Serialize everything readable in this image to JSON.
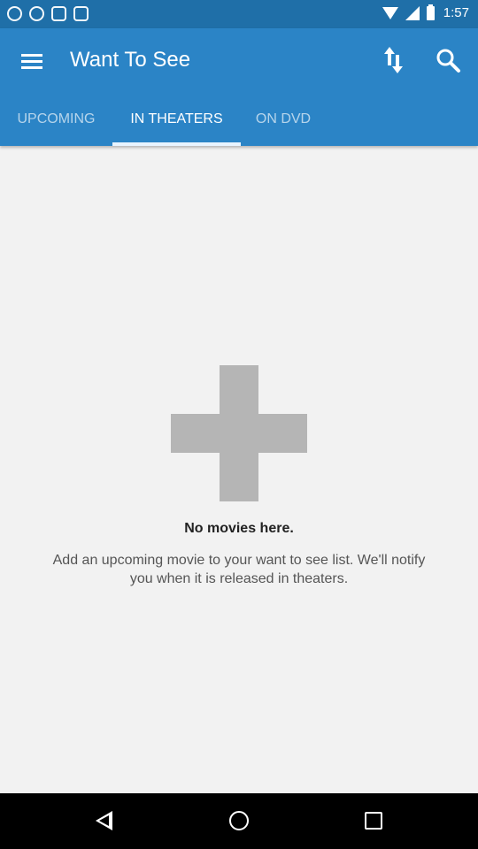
{
  "status_bar": {
    "time": "1:57"
  },
  "app_bar": {
    "title": "Want To See",
    "tabs": [
      {
        "label": "UPCOMING"
      },
      {
        "label": "IN THEATERS"
      },
      {
        "label": "ON DVD"
      }
    ],
    "active_tab": "IN THEATERS"
  },
  "empty_state": {
    "title": "No movies here.",
    "description": "Add an upcoming movie to your want to see list. We'll notify you when it is released in theaters."
  },
  "icons": {
    "menu": "hamburger-menu-icon",
    "sort": "sort-arrows-icon",
    "search": "search-icon",
    "add": "plus-icon"
  },
  "colors": {
    "app_bar": "#2b84c6",
    "status_bar": "#1f6fa8",
    "tab_indicator": "#e8f4ff",
    "placeholder_icon": "#b5b5b5"
  }
}
